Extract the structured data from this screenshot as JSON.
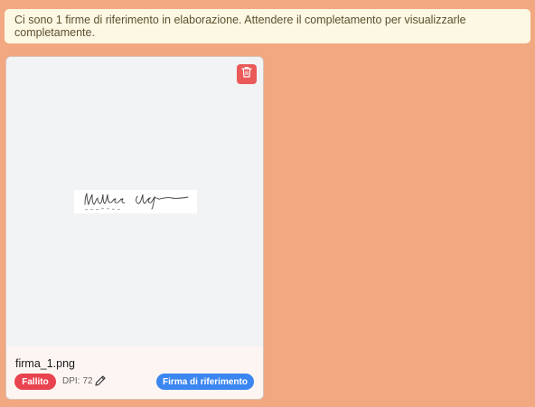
{
  "notice": {
    "text": "Ci sono 1 firme di riferimento in elaborazione. Attendere il completamento per visualizzarle completamente."
  },
  "card": {
    "filename": "firma_1.png",
    "status_badge": "Fallito",
    "dpi_label": "DPI:",
    "dpi_value": "72",
    "reference_badge": "Firma di riferimento",
    "icons": {
      "delete": "trash-icon",
      "edit": "pencil-icon"
    }
  },
  "colors": {
    "background": "#f2a880",
    "notice_bg": "#fdf8e3",
    "delete_button": "#ea5a59",
    "status_failed": "#e8434f",
    "reference_badge": "#3b86f0"
  }
}
